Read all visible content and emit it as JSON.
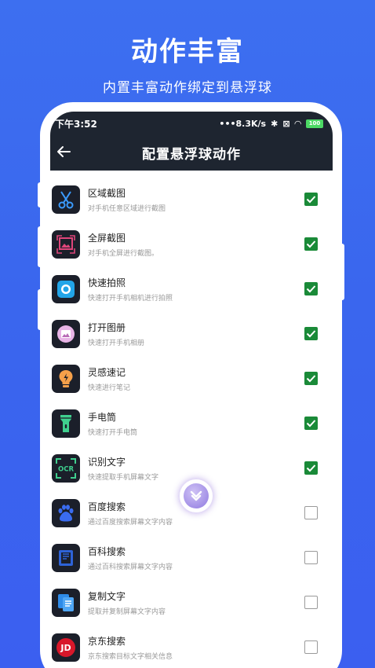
{
  "promo": {
    "title": "动作丰富",
    "subtitle": "内置丰富动作绑定到悬浮球"
  },
  "status_bar": {
    "time": "下午3:52",
    "network_speed": "•••8.3K/s",
    "battery": "100"
  },
  "app_bar": {
    "back_icon": "back-arrow-icon",
    "title": "配置悬浮球动作"
  },
  "colors": {
    "background": "#3d6ff0",
    "dark_bar": "#1e2530",
    "check_green": "#1a8a38"
  },
  "actions": [
    {
      "title": "区域截图",
      "desc": "对手机任意区域进行截图",
      "icon": "scissors-icon",
      "checked": true
    },
    {
      "title": "全屏截图",
      "desc": "对手机全屏进行截图。",
      "icon": "fullscreen-image-icon",
      "checked": true
    },
    {
      "title": "快速拍照",
      "desc": "快速打开手机相机进行拍照",
      "icon": "camera-icon",
      "checked": true
    },
    {
      "title": "打开图册",
      "desc": "快速打开手机相册",
      "icon": "gallery-icon",
      "checked": true
    },
    {
      "title": "灵感速记",
      "desc": "快速进行笔记",
      "icon": "lightbulb-icon",
      "checked": true
    },
    {
      "title": "手电筒",
      "desc": "快速打开手电筒",
      "icon": "flashlight-icon",
      "checked": true
    },
    {
      "title": "识别文字",
      "desc": "快速提取手机屏幕文字",
      "icon": "ocr-icon",
      "checked": true
    },
    {
      "title": "百度搜索",
      "desc": "通过百度搜索屏幕文字内容",
      "icon": "baidu-paw-icon",
      "checked": false
    },
    {
      "title": "百科搜索",
      "desc": "通过百科搜索屏幕文字内容",
      "icon": "encyclopedia-book-icon",
      "checked": false
    },
    {
      "title": "复制文字",
      "desc": "提取并复制屏幕文字内容",
      "icon": "copy-document-icon",
      "checked": false
    },
    {
      "title": "京东搜索",
      "desc": "京东搜索目标文字相关信息",
      "icon": "jd-logo-icon",
      "checked": false
    }
  ],
  "floating_ball": {
    "icon": "floating-ball-chevron-icon"
  }
}
